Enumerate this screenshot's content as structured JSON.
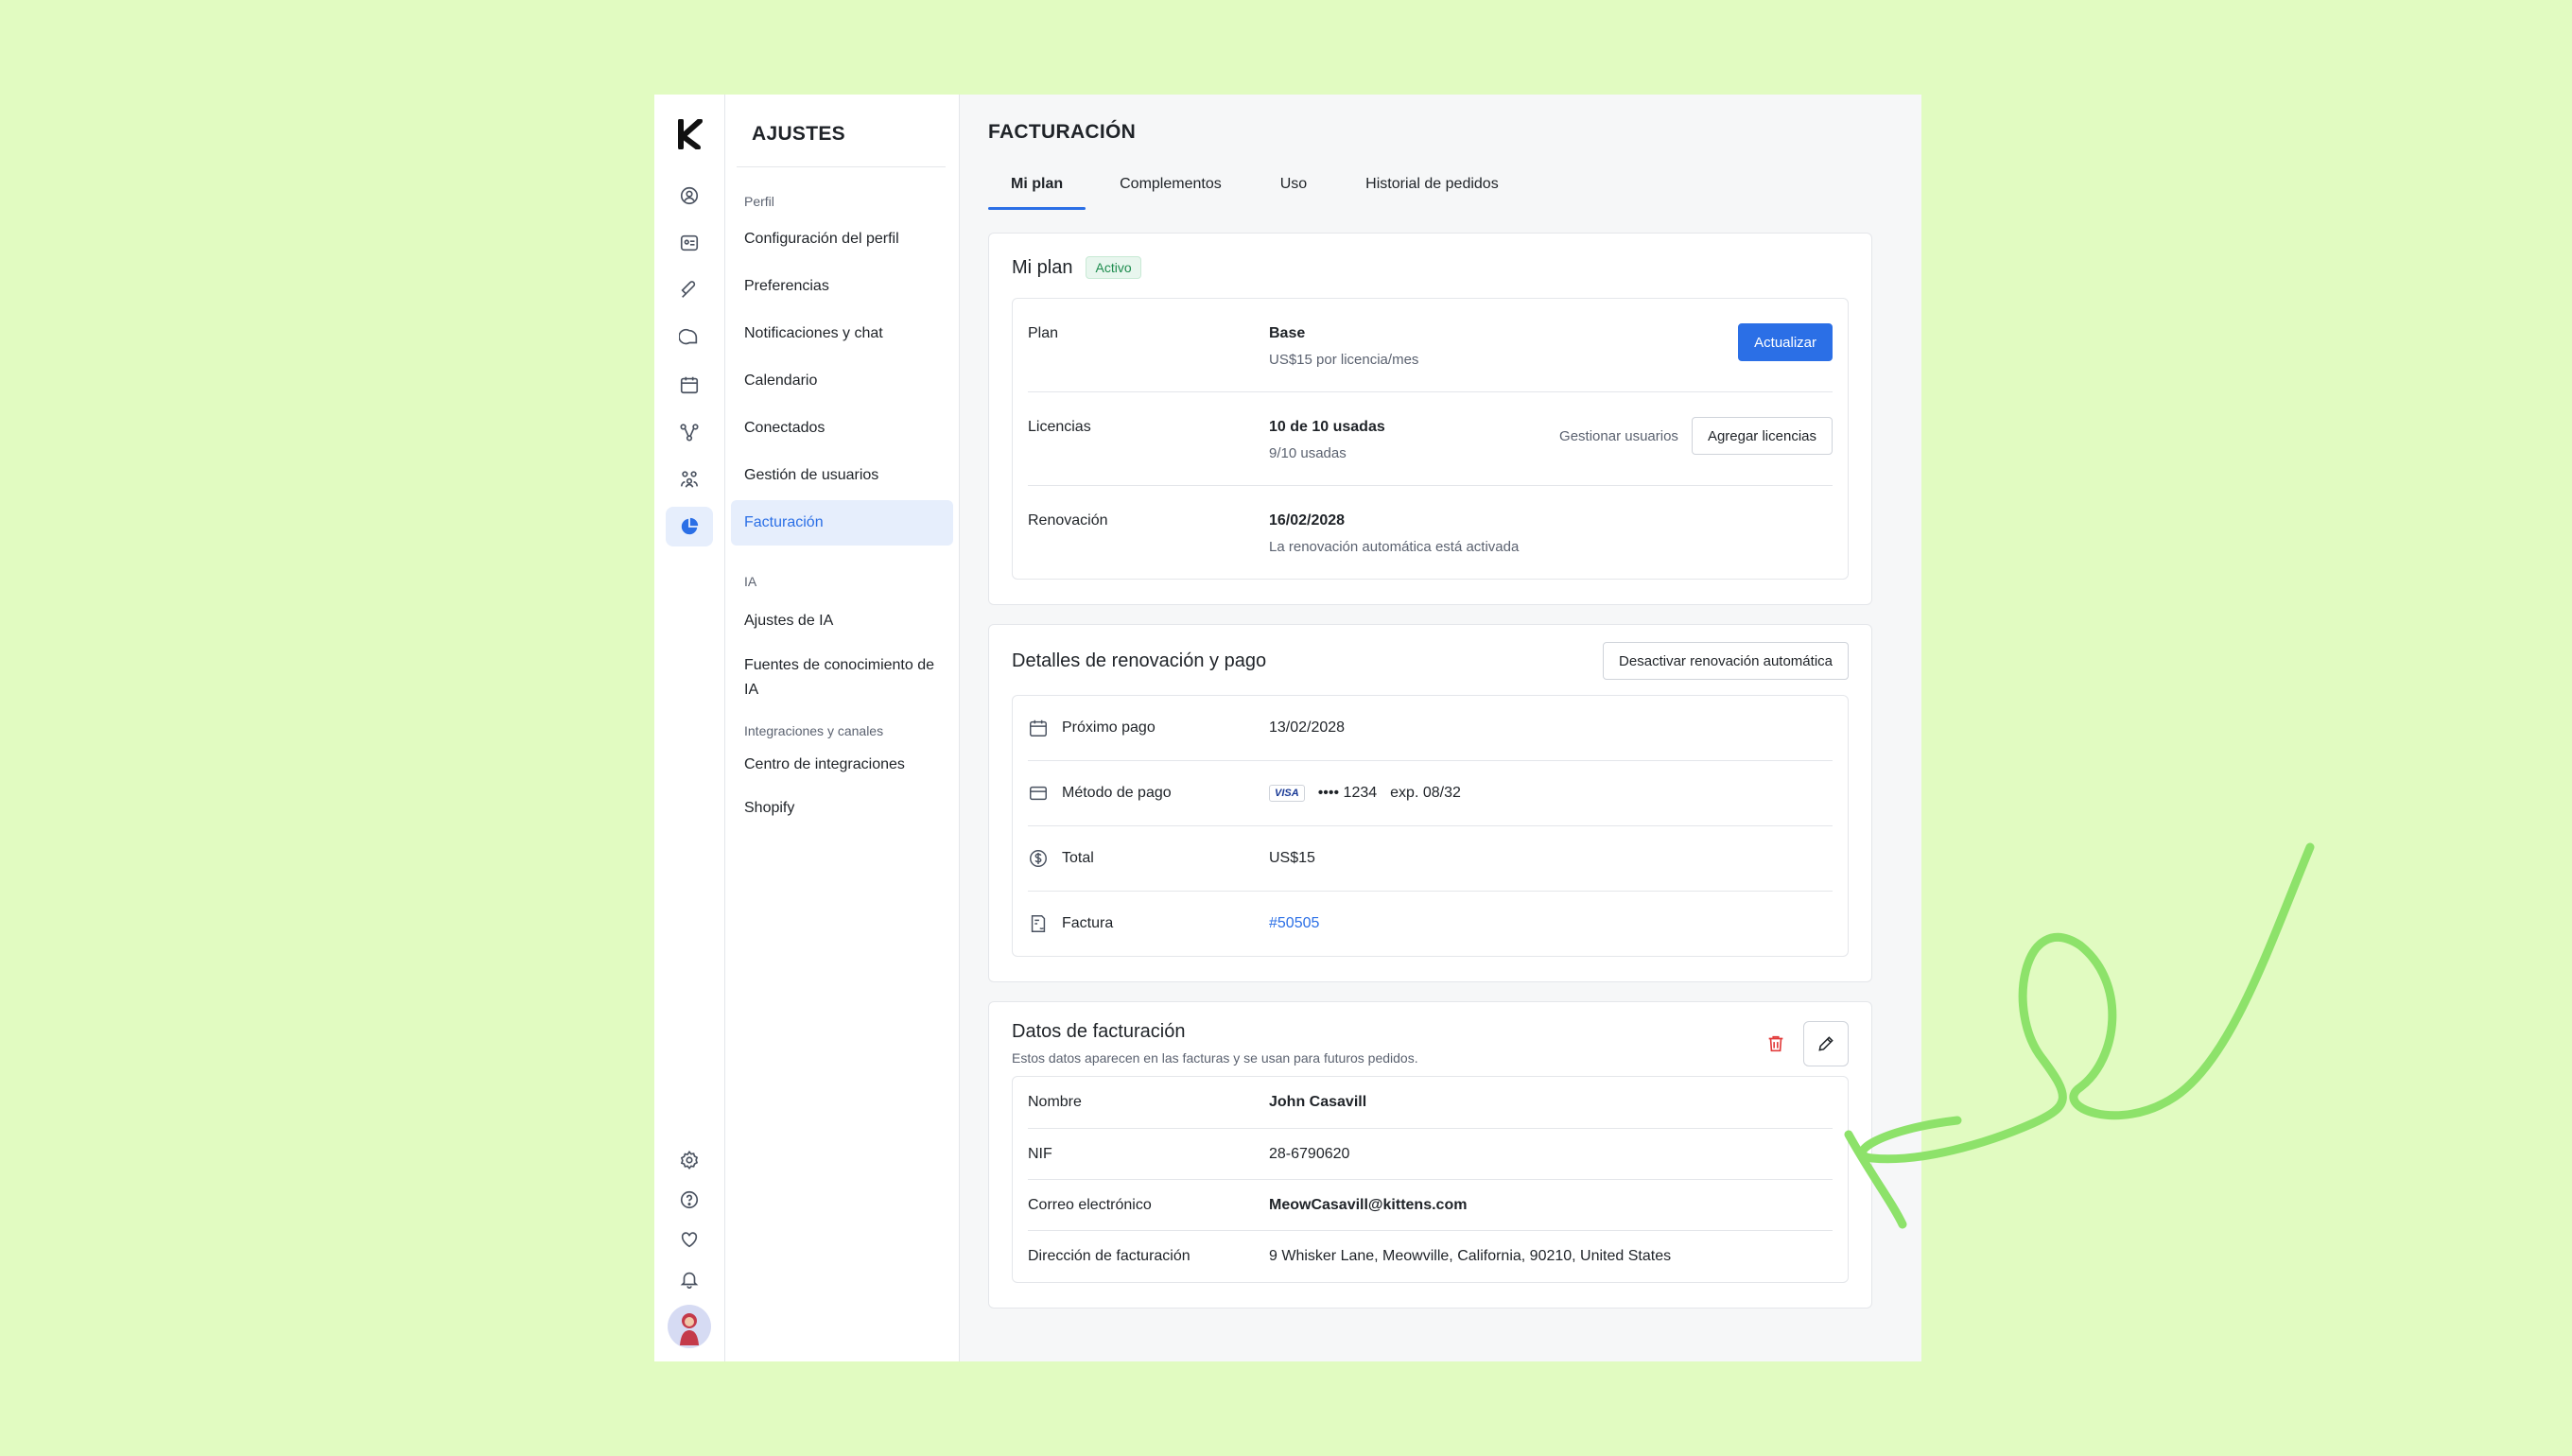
{
  "sidebar": {
    "title": "AJUSTES",
    "sections": {
      "perfil": "Perfil",
      "ia": "IA",
      "integraciones": "Integraciones y canales"
    },
    "items": [
      {
        "label": "Configuración del perfil"
      },
      {
        "label": "Preferencias"
      },
      {
        "label": "Notificaciones y chat"
      },
      {
        "label": "Calendario"
      },
      {
        "label": "Conectados"
      },
      {
        "label": "Gestión de usuarios"
      },
      {
        "label": "Facturación"
      },
      {
        "label": "Ajustes de IA"
      },
      {
        "label": "Fuentes de conocimiento de IA"
      },
      {
        "label": "Centro de integraciones"
      },
      {
        "label": "Shopify"
      }
    ]
  },
  "header": {
    "title": "FACTURACIÓN"
  },
  "tabs": [
    {
      "label": "Mi plan"
    },
    {
      "label": "Complementos"
    },
    {
      "label": "Uso"
    },
    {
      "label": "Historial de pedidos"
    }
  ],
  "plan_card": {
    "title": "Mi plan",
    "badge": "Activo",
    "plan_label": "Plan",
    "plan_value": "Base",
    "plan_price": "US$15 por licencia/mes",
    "upgrade_button": "Actualizar",
    "licenses_label": "Licencias",
    "licenses_value": "10 de 10 usadas",
    "licenses_sub": "9/10 usadas",
    "manage_users": "Gestionar usuarios",
    "add_licenses_button": "Agregar licencias",
    "renewal_label": "Renovación",
    "renewal_value": "16/02/2028",
    "renewal_sub": "La renovación automática está activada"
  },
  "renewal_card": {
    "title": "Detalles de renovación y pago",
    "disable_button": "Desactivar renovación automática",
    "next_payment_label": "Próximo pago",
    "next_payment_value": "13/02/2028",
    "method_label": "Método de pago",
    "card_brand": "VISA",
    "card_number": "•••• 1234",
    "card_exp": "exp. 08/32",
    "total_label": "Total",
    "total_value": "US$15",
    "invoice_label": "Factura",
    "invoice_value": "#50505"
  },
  "billing_card": {
    "title": "Datos de facturación",
    "subtitle": "Estos datos aparecen en las facturas y se usan para futuros pedidos.",
    "name_label": "Nombre",
    "name_value": "John Casavill",
    "nif_label": "NIF",
    "nif_value": "28-6790620",
    "email_label": "Correo electrónico",
    "email_value": "MeowCasavill@kittens.com",
    "address_label": "Dirección de facturación",
    "address_value": "9 Whisker Lane, Meowville, California, 90210, United States"
  },
  "colors": {
    "accent": "#2b6fe6",
    "background": "#e1fbc1",
    "annotation_arrow": "#8de26a",
    "danger": "#e23b3b",
    "success": "#1e8c4e"
  }
}
